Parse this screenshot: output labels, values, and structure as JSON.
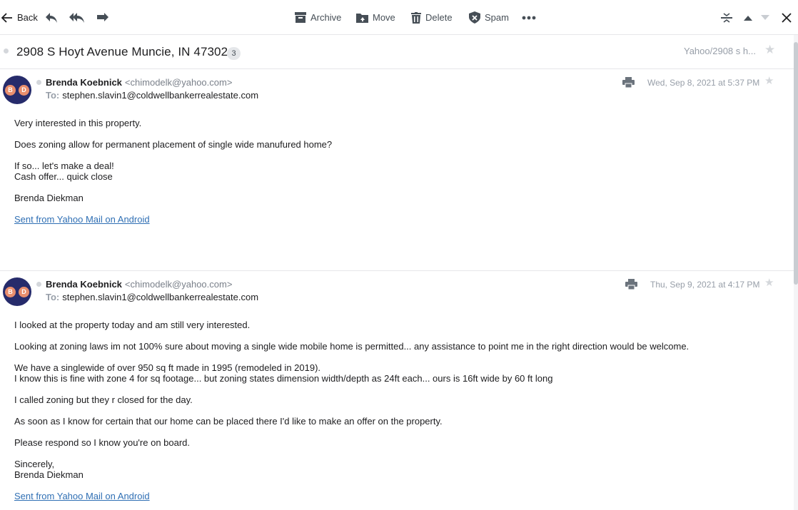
{
  "toolbar": {
    "back_label": "Back",
    "archive_label": "Archive",
    "move_label": "Move",
    "delete_label": "Delete",
    "spam_label": "Spam",
    "more_icon": "more-icon"
  },
  "thread": {
    "subject": "2908 S Hoyt Avenue Muncie, IN 47302",
    "count": "3",
    "folder_crumb": "Yahoo/2908 s h..."
  },
  "messages": [
    {
      "avatar_initials": [
        "B",
        "D"
      ],
      "sender_name": "Brenda Koebnick",
      "sender_email": "<chimodelk@yahoo.com>",
      "to_label": "To:",
      "to": "stephen.slavin1@coldwellbankerrealestate.com",
      "date": "Wed, Sep 8, 2021 at 5:37 PM",
      "paragraphs": [
        "Very interested in this property.",
        "Does zoning allow for permanent placement of single wide manufured home?",
        "If so... let's make a deal!\nCash offer... quick close",
        "Brenda Diekman"
      ],
      "link": "Sent from Yahoo Mail on Android"
    },
    {
      "avatar_initials": [
        "B",
        "D"
      ],
      "sender_name": "Brenda Koebnick",
      "sender_email": "<chimodelk@yahoo.com>",
      "to_label": "To:",
      "to": "stephen.slavin1@coldwellbankerrealestate.com",
      "date": "Thu, Sep 9, 2021 at 4:17 PM",
      "paragraphs": [
        "I looked at the property today and am still very interested.",
        "Looking at zoning laws im not 100% sure about moving a single wide mobile home is permitted... any assistance to point me in the right direction would be welcome.",
        "We have a singlewide of over 950 sq ft made in 1995 (remodeled in 2019).\nI know this is fine with zone 4 for sq footage... but zoning states dimension width/depth as 24ft each... ours is 16ft wide by 60 ft long",
        "I called zoning but they r closed for the day.",
        "As soon as I know for certain that our home can be placed there I'd like to make an offer on the property.",
        "Please respond so I know you're on board.",
        "Sincerely,\nBrenda Diekman"
      ],
      "link": "Sent from Yahoo Mail on Android"
    }
  ],
  "colors": {
    "accent_link": "#2f6fb4",
    "avatar_bg": "#262b6b",
    "avatar_dot": "#e98e6d",
    "muted_text": "#979ea8"
  }
}
